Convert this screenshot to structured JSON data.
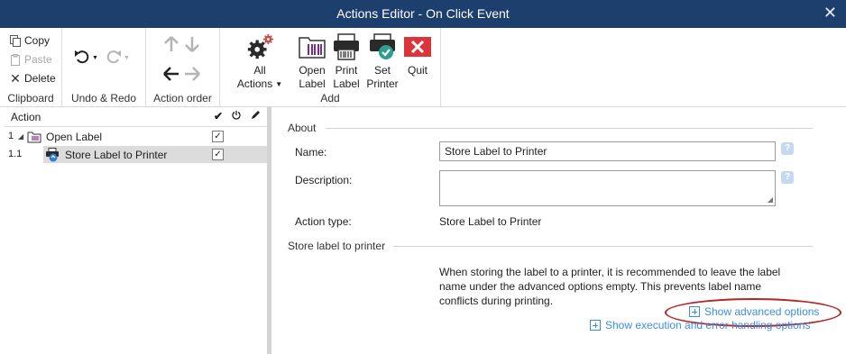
{
  "window": {
    "title": "Actions Editor - On Click Event"
  },
  "ribbon": {
    "clipboard": {
      "copy": "Copy",
      "paste": "Paste",
      "delete": "Delete",
      "label": "Clipboard"
    },
    "undo_redo": {
      "label": "Undo & Redo"
    },
    "action_order": {
      "label": "Action order"
    },
    "add": {
      "all_actions_line1": "All",
      "all_actions_line2": "Actions",
      "open_label_line1": "Open",
      "open_label_line2": "Label",
      "print_label_line1": "Print",
      "print_label_line2": "Label",
      "set_printer_line1": "Set",
      "set_printer_line2": "Printer",
      "quit": "Quit",
      "label": "Add"
    }
  },
  "tree": {
    "header": "Action",
    "rows": [
      {
        "num": "1",
        "label": "Open Label",
        "checked": "✓"
      },
      {
        "num": "1.1",
        "label": "Store Label to Printer",
        "checked": "✓"
      }
    ]
  },
  "about": {
    "title": "About",
    "name_label": "Name:",
    "name_value": "Store Label to Printer",
    "description_label": "Description:",
    "description_value": "",
    "action_type_label": "Action type:",
    "action_type_value": "Store Label to Printer",
    "help": "?"
  },
  "store": {
    "title": "Store label to printer",
    "info": "When storing the label to a printer, it is recommended to leave the label name under the advanced options empty. This prevents label name conflicts during printing.",
    "advanced": "Show advanced options",
    "execution": "Show execution and error handling options"
  },
  "colors": {
    "titlebar": "#1c3f6e",
    "link": "#3a8ee0",
    "highlight_ellipse": "#b32626",
    "quit": "#d9353a"
  }
}
